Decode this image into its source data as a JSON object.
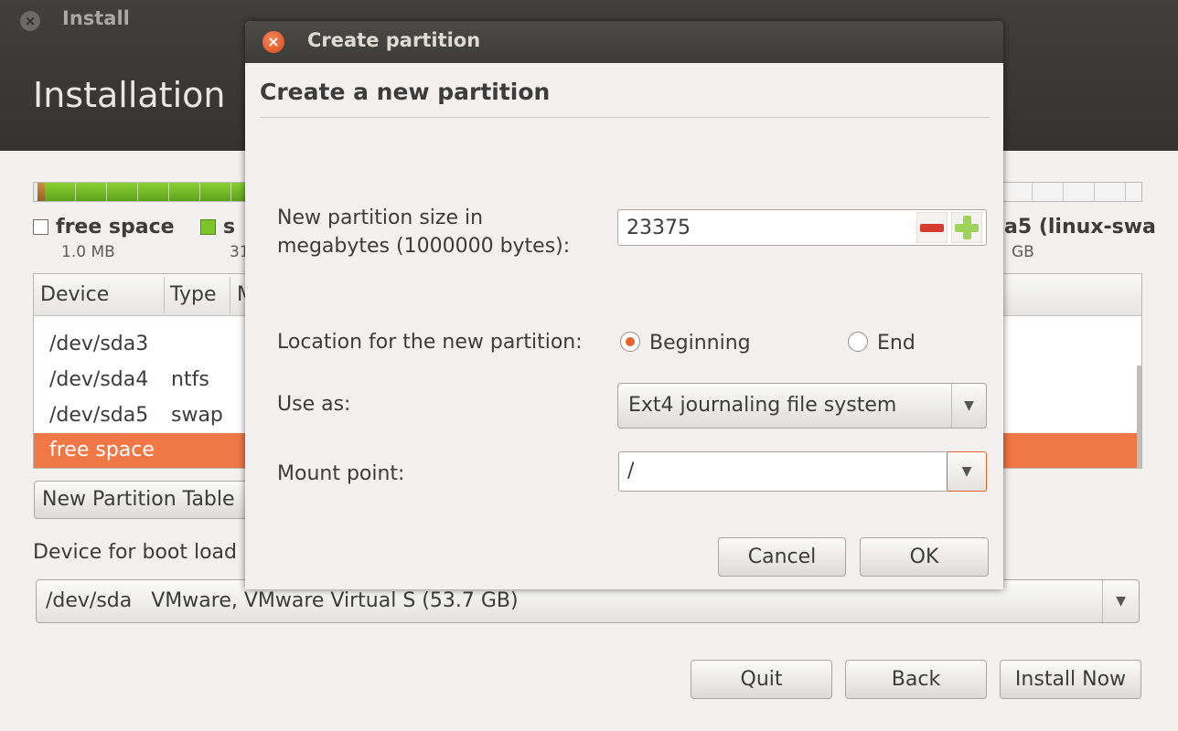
{
  "window": {
    "title": "Install",
    "heading": "Installation"
  },
  "legend": [
    {
      "name": "free space",
      "size": "1.0 MB",
      "color": "#ffffff"
    },
    {
      "name": "s",
      "size": "31",
      "color": "#7bc52a"
    },
    {
      "name": "a5 (linux-swa",
      "size": "GB",
      "color": ""
    }
  ],
  "table": {
    "columns": [
      "Device",
      "Type",
      "M"
    ],
    "rows": [
      {
        "device": "/dev/sda3",
        "type": ""
      },
      {
        "device": "/dev/sda4",
        "type": "ntfs"
      },
      {
        "device": "/dev/sda5",
        "type": "swap"
      },
      {
        "device": "free space",
        "type": "",
        "selected": true
      }
    ]
  },
  "new_partition_table_label": "New Partition Table",
  "boot_loader": {
    "label": "Device for boot load",
    "device": "/dev/sda",
    "description": "VMware, VMware Virtual S (53.7 GB)"
  },
  "buttons": {
    "quit": "Quit",
    "back": "Back",
    "install_now": "Install Now"
  },
  "dialog": {
    "title": "Create partition",
    "heading": "Create a new partition",
    "size_label_line1": "New partition size in",
    "size_label_line2": "megabytes (1000000 bytes):",
    "size_value": "23375",
    "location_label": "Location for the new partition:",
    "location_options": [
      "Beginning",
      "End"
    ],
    "location_selected": "Beginning",
    "use_as_label": "Use as:",
    "use_as_value": "Ext4 journaling file system",
    "mount_label": "Mount point:",
    "mount_value": "/",
    "cancel": "Cancel",
    "ok": "OK"
  },
  "colors": {
    "accent": "#e8612c",
    "selection": "#f07746",
    "titlebar": "#3c3b37"
  }
}
